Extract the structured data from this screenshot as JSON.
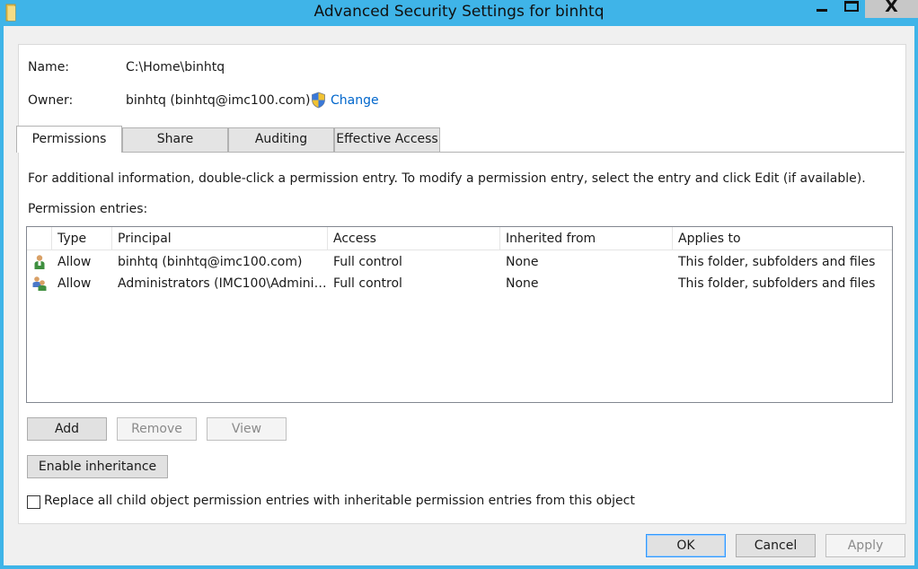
{
  "window": {
    "title": "Advanced Security Settings for binhtq",
    "controls": {
      "minimize_icon": "minimize-icon",
      "maximize_icon": "maximize-icon",
      "close_glyph": "X"
    }
  },
  "info": {
    "name_label": "Name:",
    "name_value": "C:\\Home\\binhtq",
    "owner_label": "Owner:",
    "owner_value": "binhtq (binhtq@imc100.com)",
    "change_link": "Change"
  },
  "tabs": [
    {
      "label": "Permissions",
      "active": true
    },
    {
      "label": "Share",
      "active": false
    },
    {
      "label": "Auditing",
      "active": false
    },
    {
      "label": "Effective Access",
      "active": false
    }
  ],
  "permissions": {
    "info_text": "For additional information, double-click a permission entry. To modify a permission entry, select the entry and click Edit (if available).",
    "entries_label": "Permission entries:",
    "columns": [
      "Type",
      "Principal",
      "Access",
      "Inherited from",
      "Applies to"
    ],
    "rows": [
      {
        "icon": "user-icon",
        "type": "Allow",
        "principal": "binhtq (binhtq@imc100.com)",
        "access": "Full control",
        "inherited_from": "None",
        "applies_to": "This folder, subfolders and files"
      },
      {
        "icon": "group-icon",
        "type": "Allow",
        "principal": "Administrators (IMC100\\Adminis...",
        "access": "Full control",
        "inherited_from": "None",
        "applies_to": "This folder, subfolders and files"
      }
    ]
  },
  "buttons": {
    "add": "Add",
    "remove": "Remove",
    "view": "View",
    "enable_inheritance": "Enable inheritance"
  },
  "replace_checkbox": {
    "label": "Replace all child object permission entries with inheritable permission entries from this object",
    "checked": false
  },
  "dialog_buttons": {
    "ok": "OK",
    "cancel": "Cancel",
    "apply": "Apply"
  },
  "colors": {
    "titlebar": "#3fb4e8",
    "link": "#0066cc",
    "disabled_text": "#8a8a8a"
  }
}
